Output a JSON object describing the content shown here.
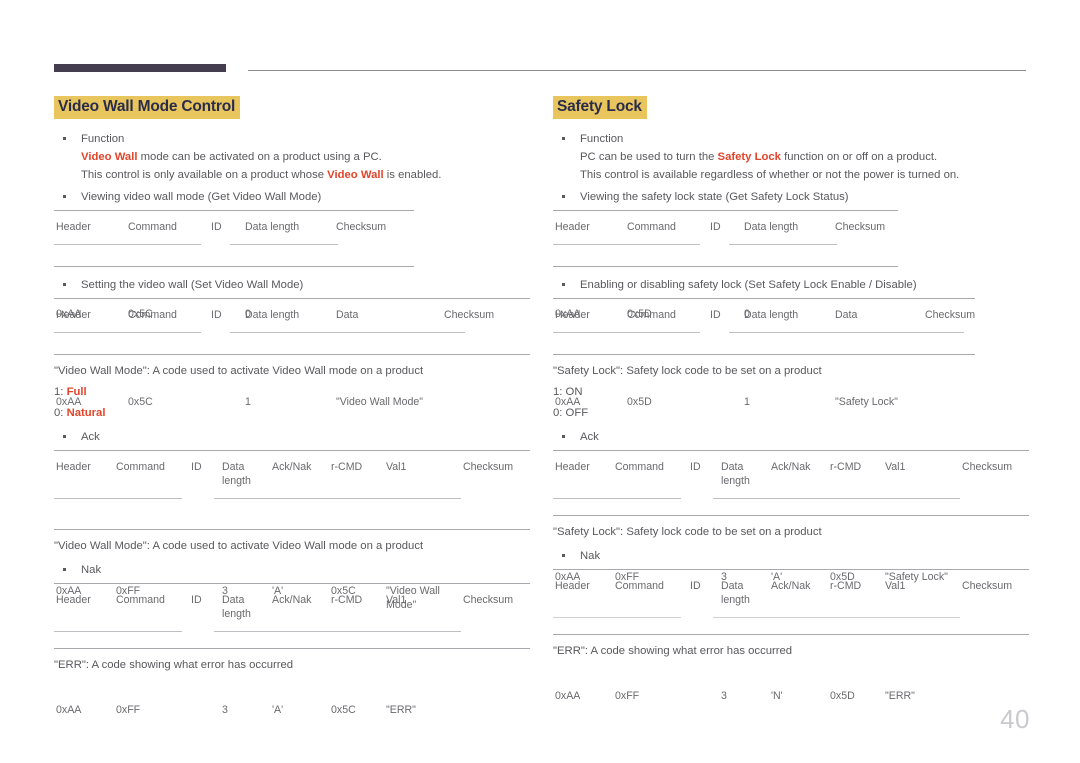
{
  "page": {
    "number": "40"
  },
  "left": {
    "title": "Video Wall Mode Control",
    "function": {
      "heading": "Function",
      "line1_pre": "",
      "line1_kw": "Video Wall",
      "line1_post": " mode can be activated on a product using a PC.",
      "line2_pre": "This control is only available on a product whose ",
      "line2_kw": "Video Wall",
      "line2_post": " is enabled."
    },
    "get_label": "Viewing video wall mode (Get Video Wall Mode)",
    "get_table": {
      "headers": [
        "Header",
        "Command",
        "ID",
        "Data length",
        "Checksum"
      ],
      "values": [
        "0xAA",
        "0x5C",
        "",
        "0",
        ""
      ]
    },
    "set_label": "Setting the video wall (Set Video Wall Mode)",
    "set_table": {
      "headers": [
        "Header",
        "Command",
        "ID",
        "Data length",
        "Data",
        "Checksum"
      ],
      "values": [
        "0xAA",
        "0x5C",
        "",
        "1",
        "\"Video Wall Mode\"",
        ""
      ]
    },
    "set_note": "\"Video Wall Mode\": A code used to activate Video Wall mode on a product",
    "opt1_num": "1: ",
    "opt1_val": "Full",
    "opt0_num": "0: ",
    "opt0_val": "Natural",
    "ack_label": "Ack",
    "ack_table": {
      "headers": [
        "Header",
        "Command",
        "ID",
        "Data\nlength",
        "Ack/Nak",
        "r-CMD",
        "Val1",
        "Checksum"
      ],
      "values": [
        "0xAA",
        "0xFF",
        "",
        "3",
        "'A'",
        "0x5C",
        "\"Video Wall\nMode\"",
        ""
      ]
    },
    "ack_note": "\"Video Wall Mode\": A code used to activate Video Wall mode on a product",
    "nak_label": "Nak",
    "nak_table": {
      "headers": [
        "Header",
        "Command",
        "ID",
        "Data\nlength",
        "Ack/Nak",
        "r-CMD",
        "Val1",
        "Checksum"
      ],
      "values": [
        "0xAA",
        "0xFF",
        "",
        "3",
        "'A'",
        "0x5C",
        "\"ERR\"",
        ""
      ]
    },
    "nak_note": "\"ERR\": A code showing what error has occurred"
  },
  "right": {
    "title": "Safety Lock",
    "function": {
      "heading": "Function",
      "line1_pre": "PC can be used to turn the ",
      "line1_kw": "Safety Lock",
      "line1_post": " function on or off on a product.",
      "line2": "This control is available regardless of whether or not the power is turned on."
    },
    "get_label": "Viewing the safety lock state (Get Safety Lock Status)",
    "get_table": {
      "headers": [
        "Header",
        "Command",
        "ID",
        "Data length",
        "Checksum"
      ],
      "values": [
        "0xAA",
        "0x5D",
        "",
        "0",
        ""
      ]
    },
    "set_label": "Enabling or disabling safety lock (Set Safety Lock Enable / Disable)",
    "set_table": {
      "headers": [
        "Header",
        "Command",
        "ID",
        "Data length",
        "Data",
        "Checksum"
      ],
      "values": [
        "0xAA",
        "0x5D",
        "",
        "1",
        "\"Safety Lock\"",
        ""
      ]
    },
    "set_note": "\"Safety Lock\": Safety lock code to be set on a product",
    "opt1": "1: ON",
    "opt0": "0: OFF",
    "ack_label": "Ack",
    "ack_table": {
      "headers": [
        "Header",
        "Command",
        "ID",
        "Data\nlength",
        "Ack/Nak",
        "r-CMD",
        "Val1",
        "Checksum"
      ],
      "values": [
        "0xAA",
        "0xFF",
        "",
        "3",
        "'A'",
        "0x5D",
        "\"Safety Lock\"",
        ""
      ]
    },
    "ack_note": "\"Safety Lock\": Safety lock code to be set on a product",
    "nak_label": "Nak",
    "nak_table": {
      "headers": [
        "Header",
        "Command",
        "ID",
        "Data\nlength",
        "Ack/Nak",
        "r-CMD",
        "Val1",
        "Checksum"
      ],
      "values": [
        "0xAA",
        "0xFF",
        "",
        "3",
        "'N'",
        "0x5D",
        "\"ERR\"",
        ""
      ]
    },
    "nak_note": "\"ERR\": A code showing what error has occurred"
  },
  "colors": {
    "accent_red": "#e2452a",
    "title_highlight": "#e9c55e",
    "title_text": "#2a2d4a",
    "rule_dark": "#443c4f",
    "body_text": "#59585c"
  }
}
